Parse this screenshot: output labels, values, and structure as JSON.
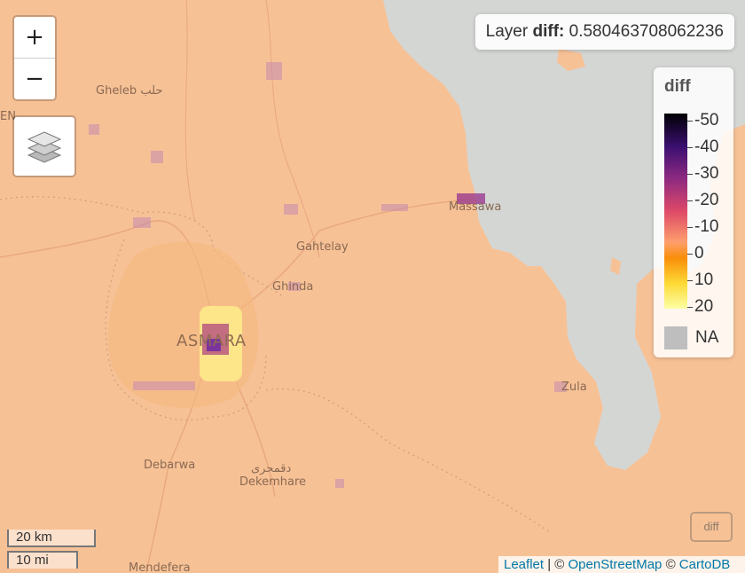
{
  "map": {
    "places": [
      {
        "name": "Gheleb حلب",
        "kind": "town"
      },
      {
        "name": "Massawa",
        "kind": "town"
      },
      {
        "name": "Gahtelay",
        "kind": "town"
      },
      {
        "name": "Ghinda",
        "kind": "town"
      },
      {
        "name": "ASMARA",
        "kind": "city"
      },
      {
        "name": "Zula",
        "kind": "town"
      },
      {
        "name": "Debarwa",
        "kind": "town"
      },
      {
        "name": "دقمحری",
        "kind": "town"
      },
      {
        "name": "Dekemhare",
        "kind": "town"
      },
      {
        "name": "Mendefera",
        "kind": "town"
      },
      {
        "name": "EN",
        "kind": "edge"
      }
    ],
    "colors": {
      "land": "#f7c196",
      "sea": "#d4d6d4",
      "road": "#e9a97f",
      "border": "#c9a07c"
    }
  },
  "zoom": {
    "in_label": "+",
    "out_label": "−"
  },
  "layers": {
    "icon": "layers-icon"
  },
  "layer_info": {
    "prefix": "Layer",
    "name": "diff:",
    "value": "0.580463708062236"
  },
  "legend": {
    "title": "diff",
    "ticks": [
      "-50",
      "-40",
      "-30",
      "-20",
      "-10",
      "0",
      "10",
      "20"
    ],
    "na_label": "NA",
    "colors": [
      "#000004",
      "#3b0f70",
      "#8c2981",
      "#de4968",
      "#fe9f6d",
      "#f98e09",
      "#fdd935",
      "#fcffa4"
    ]
  },
  "mini_button": {
    "label": "diff"
  },
  "scale": {
    "km": "20 km",
    "mi": "10 mi"
  },
  "attribution": {
    "leaflet": "Leaflet",
    "sep1": " | © ",
    "osm": "OpenStreetMap",
    "sep2": " © ",
    "carto": "CartoDB"
  }
}
